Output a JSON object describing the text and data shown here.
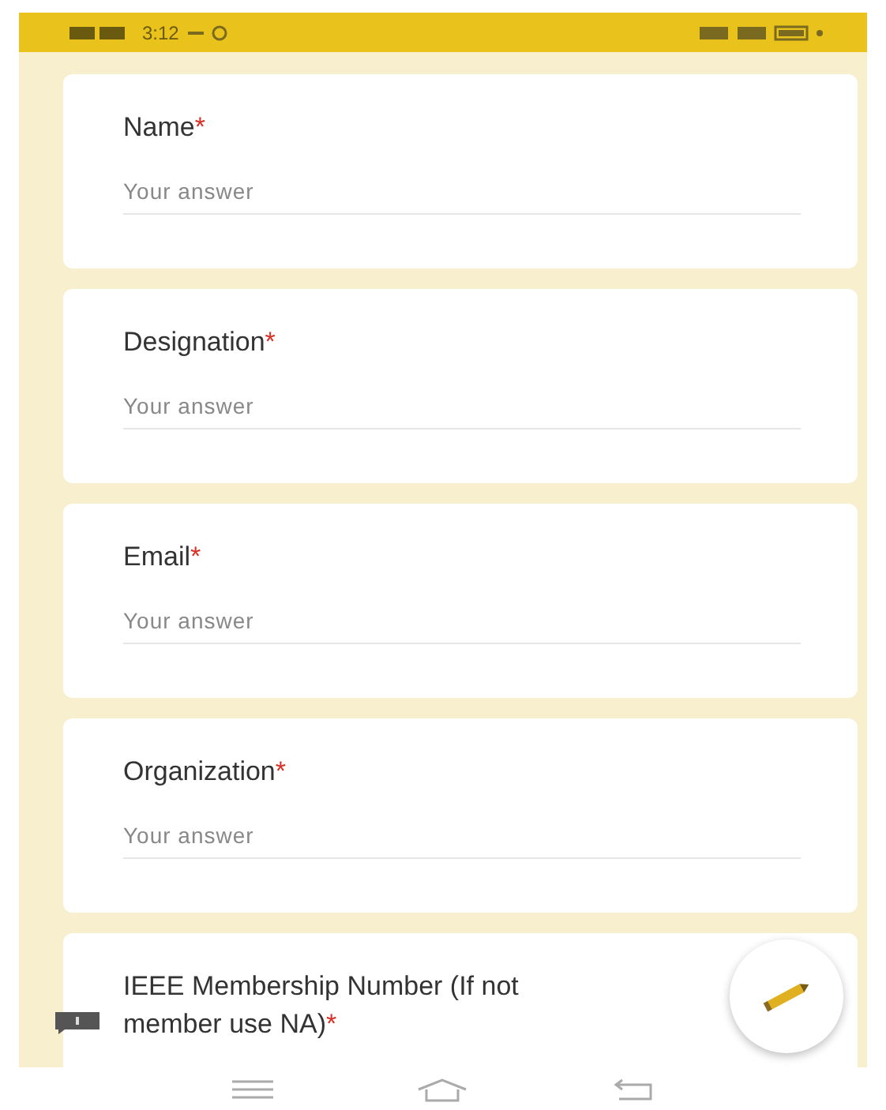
{
  "status_bar": {
    "time": "3:12"
  },
  "questions": [
    {
      "title_lines": [
        "Name"
      ],
      "required_mark": "*",
      "placeholder": "Your answer"
    },
    {
      "title_lines": [
        "Designation"
      ],
      "required_mark": "*",
      "placeholder": "Your answer"
    },
    {
      "title_lines": [
        "Email"
      ],
      "required_mark": "*",
      "placeholder": "Your answer"
    },
    {
      "title_lines": [
        "Organization"
      ],
      "required_mark": "*",
      "placeholder": "Your answer"
    },
    {
      "title_lines": [
        "IEEE Membership Number (If not",
        "member use NA)"
      ],
      "required_mark": "*"
    }
  ]
}
